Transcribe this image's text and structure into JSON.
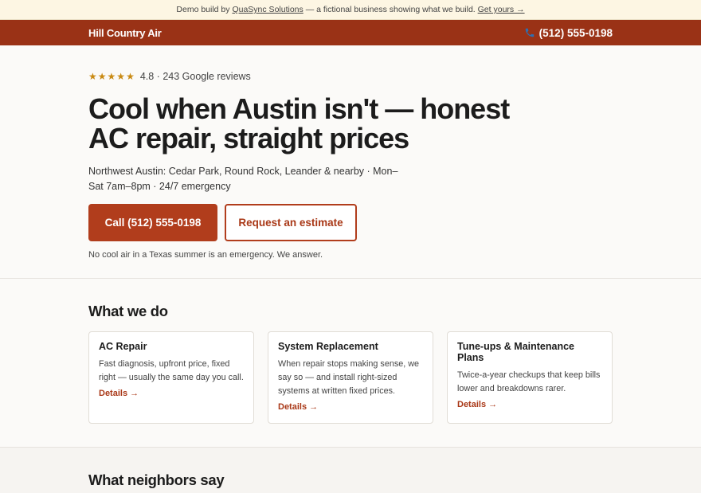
{
  "demo_bar": {
    "prefix": "Demo build by",
    "company_link": "QuaSync Solutions",
    "middle": "— a fictional business showing what we build.",
    "cta_link": "Get yours →"
  },
  "header": {
    "brand": "Hill Country Air",
    "phone": "(512) 555-0198"
  },
  "hero": {
    "rating_text": "4.8 · 243 Google reviews",
    "stars": 5,
    "headline": "Cool when Austin isn't — honest AC repair, straight prices",
    "subhead": "Northwest Austin: Cedar Park, Round Rock, Leander & nearby · Mon–Sat 7am–8pm · 24/7 emergency",
    "primary_cta": "Call (512) 555-0198",
    "secondary_cta": "Request an estimate",
    "note": "No cool air in a Texas summer is an emergency. We answer."
  },
  "services": {
    "heading": "What we do",
    "items": [
      {
        "title": "AC Repair",
        "description": "Fast diagnosis, upfront price, fixed right — usually the same day you call.",
        "link": "Details →"
      },
      {
        "title": "System Replacement",
        "description": "When repair stops making sense, we say so — and install right-sized systems at written fixed prices.",
        "link": "Details →"
      },
      {
        "title": "Tune-ups & Maintenance Plans",
        "description": "Twice-a-year checkups that keep bills lower and breakdowns rarer.",
        "link": "Details →"
      }
    ]
  },
  "testimonials": {
    "heading": "What neighbors say"
  },
  "colors": {
    "brand": "#9a3216",
    "accent": "#b13d1c",
    "star": "#c98a13"
  }
}
